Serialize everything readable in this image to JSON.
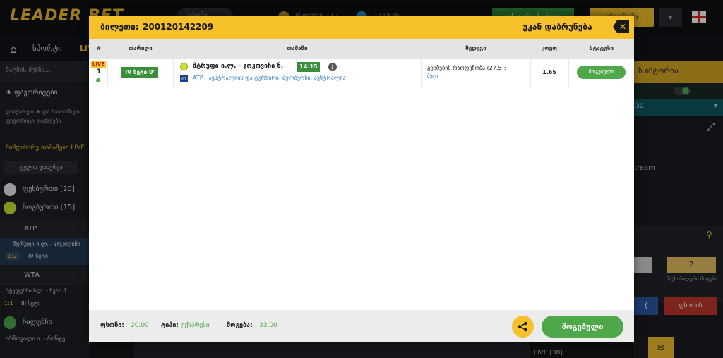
{
  "app": {
    "logo": "LEADER BET",
    "top_search": "კუპონი",
    "top_user": "ესოლიე 777",
    "top_balance": "271876",
    "top_green_button": "აქტიური ბონუსი",
    "top_yellow_button": "ანგარიში",
    "nav": {
      "sports": "სპორტი",
      "live": "LIVE"
    }
  },
  "sidebar": {
    "search_placeholder": "მატჩის ძებნა...",
    "favorites_title": "★ ფავორიტები",
    "favorites_text": "დააჭირეთ ★ და ჩაინიშნეთ ფავორიტი თამაშები",
    "live_title": "მიმდინარე თამაშები LIVE",
    "clear_button": "ცვლის დახურვა",
    "sports": [
      {
        "label": "ფეხბურთი [20]",
        "color": "#ffffff"
      },
      {
        "label": "ჩოგბურთი [15]",
        "color": "#cde332"
      }
    ],
    "league_atp": "ATP",
    "match1": {
      "teams": "შტრუფი ი.ლ. - ჯოკოვიჩი",
      "score": "1:2",
      "period": "IV სეტი"
    },
    "league_wta": "WTA",
    "match2": {
      "teams": "სტეფენსი სლ. - ჩვან შ.",
      "score": "1:1",
      "period": "III სეტი"
    },
    "sport3": "ჩილენჩი",
    "match3": {
      "teams": "არჩოვალი ა. - რინდე"
    }
  },
  "right_panel": {
    "history_title": "ს ისტორია",
    "teal_value": "30",
    "stream_text": "tream",
    "number_box": "2",
    "win_label": "მაქსიმალური მოგება",
    "bet_button": "ფსონის",
    "live_count": "LIVE [38]"
  },
  "modal": {
    "ticket_label": "ბილეთი:",
    "ticket_id": "200120142209",
    "back_label": "უკან დაბრუნება",
    "columns": {
      "num": "#",
      "date": "თარიღი",
      "game": "თამაში",
      "outcome": "შედეგი",
      "odds": "კოეფ",
      "status": "სტატუსი"
    },
    "rows": [
      {
        "live": "LIVE",
        "num": "1",
        "period": "IV სეტი 0'",
        "match": "შტრუფი ი.ლ. - ჯოკოვიჩი ნ.",
        "time": "14:15",
        "league": "ATP - ავსტრალიის და ტურნირი, მელბურნი, ავსტრალია",
        "market": "გეიმების რაოდენობა (27.5):",
        "pick": "მეტი",
        "odds": "1.65",
        "status": "მოგებული"
      }
    ],
    "footer": {
      "stake_label": "ფსონი:",
      "stake_value": "20.00",
      "type_label": "ტიპი:",
      "type_value": "ექსპრესი",
      "win_label": "მოგება:",
      "win_value": "33.00",
      "won_button": "მოგებული"
    }
  },
  "colors": {
    "accent_yellow": "#f6c12b",
    "won_green": "#4ea84a",
    "link_blue": "#3a7fbf"
  }
}
